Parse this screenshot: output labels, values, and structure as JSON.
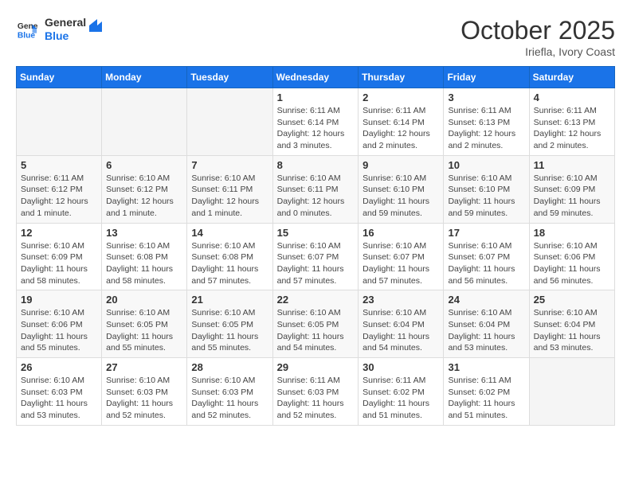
{
  "header": {
    "logo_line1": "General",
    "logo_line2": "Blue",
    "month": "October 2025",
    "location": "Iriefla, Ivory Coast"
  },
  "days_of_week": [
    "Sunday",
    "Monday",
    "Tuesday",
    "Wednesday",
    "Thursday",
    "Friday",
    "Saturday"
  ],
  "weeks": [
    [
      {
        "day": "",
        "info": ""
      },
      {
        "day": "",
        "info": ""
      },
      {
        "day": "",
        "info": ""
      },
      {
        "day": "1",
        "info": "Sunrise: 6:11 AM\nSunset: 6:14 PM\nDaylight: 12 hours and 3 minutes."
      },
      {
        "day": "2",
        "info": "Sunrise: 6:11 AM\nSunset: 6:14 PM\nDaylight: 12 hours and 2 minutes."
      },
      {
        "day": "3",
        "info": "Sunrise: 6:11 AM\nSunset: 6:13 PM\nDaylight: 12 hours and 2 minutes."
      },
      {
        "day": "4",
        "info": "Sunrise: 6:11 AM\nSunset: 6:13 PM\nDaylight: 12 hours and 2 minutes."
      }
    ],
    [
      {
        "day": "5",
        "info": "Sunrise: 6:11 AM\nSunset: 6:12 PM\nDaylight: 12 hours and 1 minute."
      },
      {
        "day": "6",
        "info": "Sunrise: 6:10 AM\nSunset: 6:12 PM\nDaylight: 12 hours and 1 minute."
      },
      {
        "day": "7",
        "info": "Sunrise: 6:10 AM\nSunset: 6:11 PM\nDaylight: 12 hours and 1 minute."
      },
      {
        "day": "8",
        "info": "Sunrise: 6:10 AM\nSunset: 6:11 PM\nDaylight: 12 hours and 0 minutes."
      },
      {
        "day": "9",
        "info": "Sunrise: 6:10 AM\nSunset: 6:10 PM\nDaylight: 11 hours and 59 minutes."
      },
      {
        "day": "10",
        "info": "Sunrise: 6:10 AM\nSunset: 6:10 PM\nDaylight: 11 hours and 59 minutes."
      },
      {
        "day": "11",
        "info": "Sunrise: 6:10 AM\nSunset: 6:09 PM\nDaylight: 11 hours and 59 minutes."
      }
    ],
    [
      {
        "day": "12",
        "info": "Sunrise: 6:10 AM\nSunset: 6:09 PM\nDaylight: 11 hours and 58 minutes."
      },
      {
        "day": "13",
        "info": "Sunrise: 6:10 AM\nSunset: 6:08 PM\nDaylight: 11 hours and 58 minutes."
      },
      {
        "day": "14",
        "info": "Sunrise: 6:10 AM\nSunset: 6:08 PM\nDaylight: 11 hours and 57 minutes."
      },
      {
        "day": "15",
        "info": "Sunrise: 6:10 AM\nSunset: 6:07 PM\nDaylight: 11 hours and 57 minutes."
      },
      {
        "day": "16",
        "info": "Sunrise: 6:10 AM\nSunset: 6:07 PM\nDaylight: 11 hours and 57 minutes."
      },
      {
        "day": "17",
        "info": "Sunrise: 6:10 AM\nSunset: 6:07 PM\nDaylight: 11 hours and 56 minutes."
      },
      {
        "day": "18",
        "info": "Sunrise: 6:10 AM\nSunset: 6:06 PM\nDaylight: 11 hours and 56 minutes."
      }
    ],
    [
      {
        "day": "19",
        "info": "Sunrise: 6:10 AM\nSunset: 6:06 PM\nDaylight: 11 hours and 55 minutes."
      },
      {
        "day": "20",
        "info": "Sunrise: 6:10 AM\nSunset: 6:05 PM\nDaylight: 11 hours and 55 minutes."
      },
      {
        "day": "21",
        "info": "Sunrise: 6:10 AM\nSunset: 6:05 PM\nDaylight: 11 hours and 55 minutes."
      },
      {
        "day": "22",
        "info": "Sunrise: 6:10 AM\nSunset: 6:05 PM\nDaylight: 11 hours and 54 minutes."
      },
      {
        "day": "23",
        "info": "Sunrise: 6:10 AM\nSunset: 6:04 PM\nDaylight: 11 hours and 54 minutes."
      },
      {
        "day": "24",
        "info": "Sunrise: 6:10 AM\nSunset: 6:04 PM\nDaylight: 11 hours and 53 minutes."
      },
      {
        "day": "25",
        "info": "Sunrise: 6:10 AM\nSunset: 6:04 PM\nDaylight: 11 hours and 53 minutes."
      }
    ],
    [
      {
        "day": "26",
        "info": "Sunrise: 6:10 AM\nSunset: 6:03 PM\nDaylight: 11 hours and 53 minutes."
      },
      {
        "day": "27",
        "info": "Sunrise: 6:10 AM\nSunset: 6:03 PM\nDaylight: 11 hours and 52 minutes."
      },
      {
        "day": "28",
        "info": "Sunrise: 6:10 AM\nSunset: 6:03 PM\nDaylight: 11 hours and 52 minutes."
      },
      {
        "day": "29",
        "info": "Sunrise: 6:11 AM\nSunset: 6:03 PM\nDaylight: 11 hours and 52 minutes."
      },
      {
        "day": "30",
        "info": "Sunrise: 6:11 AM\nSunset: 6:02 PM\nDaylight: 11 hours and 51 minutes."
      },
      {
        "day": "31",
        "info": "Sunrise: 6:11 AM\nSunset: 6:02 PM\nDaylight: 11 hours and 51 minutes."
      },
      {
        "day": "",
        "info": ""
      }
    ]
  ]
}
